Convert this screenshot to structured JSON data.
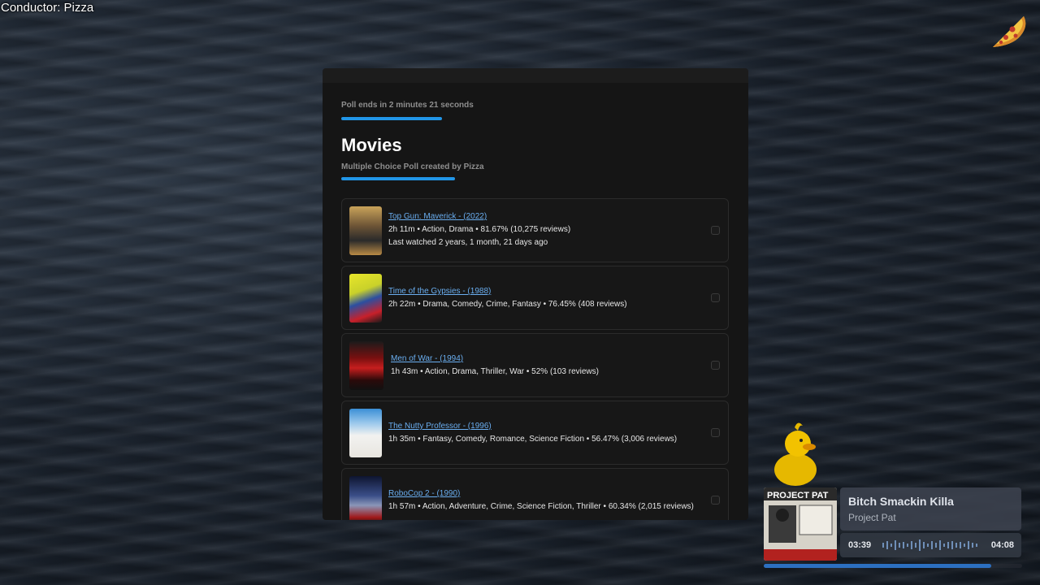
{
  "overlay": {
    "conductor_label": "Conductor: Pizza"
  },
  "poll": {
    "timer_text": "Poll ends in 2 minutes 21 seconds",
    "title": "Movies",
    "subtitle": "Multiple Choice Poll created by Pizza",
    "options": [
      {
        "title": "Top Gun: Maverick - (2022)",
        "meta": "2h 11m • Action, Drama • 81.67% (10,275 reviews)",
        "extra": "Last watched 2 years, 1 month, 21 days ago"
      },
      {
        "title": "Time of the Gypsies - (1988)",
        "meta": "2h 22m • Drama, Comedy, Crime, Fantasy • 76.45% (408 reviews)"
      },
      {
        "title": "Men of War - (1994)",
        "meta": "1h 43m • Action, Drama, Thriller, War • 52% (103 reviews)"
      },
      {
        "title": "The Nutty Professor - (1996)",
        "meta": "1h 35m • Fantasy, Comedy, Romance, Science Fiction • 56.47% (3,006 reviews)"
      },
      {
        "title": "RoboCop 2 - (1990)",
        "meta": "1h 57m • Action, Adventure, Crime, Science Fiction, Thriller • 60.34% (2,015 reviews)"
      }
    ]
  },
  "now_playing": {
    "track": "Bitch Smackin Killa",
    "artist": "Project Pat",
    "current_time": "03:39",
    "total_time": "04:08",
    "progress_fraction": 0.88,
    "album_label": "PROJECT PAT"
  },
  "colors": {
    "accent": "#2196e8",
    "link": "#6aaef0"
  }
}
